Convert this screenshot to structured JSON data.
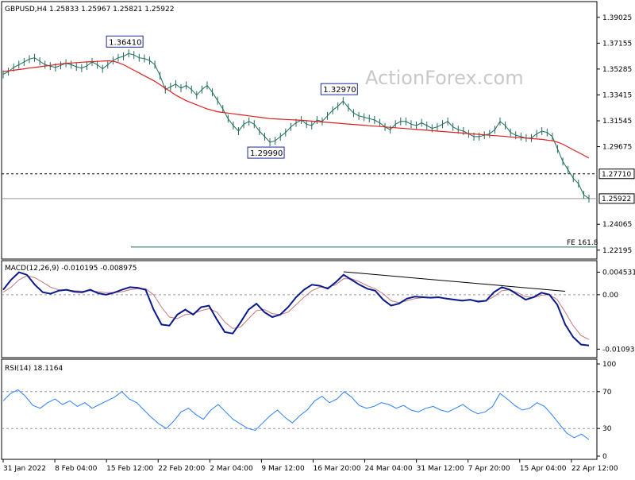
{
  "colors": {
    "price_bars": "#1f6b5c",
    "ma_line": "#e02020",
    "macd_line": "#0a1a8c",
    "signal_line": "#c87878",
    "rsi_line": "#2a7fff",
    "frame": "#000000",
    "guide": "#000000",
    "fe_line": "#1f6b5c"
  },
  "header": {
    "symbol_line": "GBPUSD,H4  1.25833 1.25967 1.25821 1.25922",
    "watermark": "ActionForex.com"
  },
  "chart_data": [
    {
      "type": "line",
      "pane": "price",
      "title": "GBPUSD,H4  1.25833 1.25967 1.25821 1.25922",
      "ylim": [
        1.2178,
        1.3993
      ],
      "y_ticks": [
        "1.39025",
        "1.37155",
        "1.35285",
        "1.33415",
        "1.31545",
        "1.29675",
        "1.27710",
        "1.25922",
        "1.24065",
        "1.22195"
      ],
      "x_ticks": [
        "31 Jan 2022",
        "8 Feb 04:00",
        "15 Feb 12:00",
        "22 Feb 20:00",
        "2 Mar 04:00",
        "9 Mar 12:00",
        "16 Mar 20:00",
        "24 Mar 04:00",
        "31 Mar 12:00",
        "7 Apr 20:00",
        "15 Apr 04:00",
        "22 Apr 12:00"
      ],
      "series": [
        {
          "name": "GBPUSD close",
          "values": [
            1.349,
            1.351,
            1.354,
            1.356,
            1.358,
            1.36,
            1.361,
            1.3585,
            1.356,
            1.355,
            1.354,
            1.3555,
            1.357,
            1.356,
            1.3545,
            1.3535,
            1.355,
            1.358,
            1.356,
            1.353,
            1.356,
            1.359,
            1.361,
            1.362,
            1.3641,
            1.363,
            1.361,
            1.3605,
            1.359,
            1.356,
            1.348,
            1.338,
            1.34,
            1.342,
            1.339,
            1.341,
            1.338,
            1.334,
            1.338,
            1.341,
            1.336,
            1.33,
            1.324,
            1.317,
            1.312,
            1.308,
            1.313,
            1.315,
            1.313,
            1.308,
            1.304,
            1.2999,
            1.301,
            1.304,
            1.307,
            1.311,
            1.314,
            1.316,
            1.313,
            1.312,
            1.316,
            1.315,
            1.319,
            1.323,
            1.326,
            1.3297,
            1.325,
            1.321,
            1.319,
            1.318,
            1.317,
            1.316,
            1.314,
            1.311,
            1.309,
            1.313,
            1.315,
            1.315,
            1.313,
            1.312,
            1.314,
            1.312,
            1.31,
            1.311,
            1.313,
            1.315,
            1.311,
            1.309,
            1.308,
            1.306,
            1.304,
            1.304,
            1.305,
            1.306,
            1.309,
            1.315,
            1.312,
            1.307,
            1.305,
            1.304,
            1.303,
            1.303,
            1.306,
            1.308,
            1.307,
            1.304,
            1.295,
            1.286,
            1.28,
            1.274,
            1.27,
            1.262,
            1.2592
          ]
        },
        {
          "name": "Moving average",
          "values": [
            1.351,
            1.3515,
            1.352,
            1.3525,
            1.353,
            1.3535,
            1.354,
            1.3545,
            1.355,
            1.3555,
            1.356,
            1.3565,
            1.357,
            1.3572,
            1.3575,
            1.3578,
            1.358,
            1.3582,
            1.3584,
            1.3586,
            1.3588,
            1.3585,
            1.3575,
            1.356,
            1.354,
            1.352,
            1.35,
            1.348,
            1.346,
            1.344,
            1.3415,
            1.339,
            1.3365,
            1.334,
            1.332,
            1.33,
            1.3285,
            1.327,
            1.3255,
            1.324,
            1.323,
            1.322,
            1.3215,
            1.321,
            1.3205,
            1.32,
            1.3195,
            1.319,
            1.3185,
            1.318,
            1.3175,
            1.317,
            1.3168,
            1.3166,
            1.3164,
            1.3162,
            1.316,
            1.3158,
            1.3155,
            1.3152,
            1.3149,
            1.3146,
            1.3143,
            1.314,
            1.3137,
            1.3134,
            1.3131,
            1.3128,
            1.3125,
            1.3122,
            1.3119,
            1.3116,
            1.3113,
            1.311,
            1.3107,
            1.3104,
            1.3101,
            1.3098,
            1.3095,
            1.3092,
            1.3089,
            1.3086,
            1.3083,
            1.308,
            1.3077,
            1.3074,
            1.3071,
            1.3068,
            1.3065,
            1.3062,
            1.3059,
            1.3056,
            1.3053,
            1.305,
            1.3047,
            1.3044,
            1.3041,
            1.3038,
            1.3035,
            1.3032,
            1.3029,
            1.3026,
            1.3023,
            1.302,
            1.3015,
            1.301,
            1.3,
            1.2985,
            1.2965,
            1.2945,
            1.2925,
            1.2905,
            1.2885
          ]
        }
      ],
      "annotations": [
        {
          "label": "1.36410",
          "x_index": 24,
          "y": 1.3641
        },
        {
          "label": "1.32970",
          "x_index": 65,
          "y": 1.3297
        },
        {
          "label": "1.29990",
          "x_index": 51,
          "y": 1.2999
        }
      ],
      "levels": [
        {
          "label": "1.27710",
          "value": 1.2771,
          "style": "dashed"
        },
        {
          "label": "1.25922",
          "value": 1.25922,
          "style": "solid"
        }
      ],
      "fe_label": "FE 161.8",
      "fe_value": 1.2242
    },
    {
      "type": "line",
      "pane": "macd",
      "title": "MACD(12,26,9) -0.010195 -0.008975",
      "ylim": [
        -0.012,
        0.0062
      ],
      "y_ticks": [
        "0.004531",
        "0.00",
        "-0.010939"
      ],
      "series": [
        {
          "name": "MACD",
          "values": [
            0.001,
            0.003,
            0.0045,
            0.004,
            0.002,
            0.0005,
            0.0002,
            0.0008,
            0.001,
            0.0006,
            0.0005,
            0.001,
            0.0003,
            0.0,
            0.0004,
            0.001,
            0.0015,
            0.0014,
            0.001,
            -0.003,
            -0.006,
            -0.0062,
            -0.004,
            -0.003,
            -0.004,
            -0.0025,
            -0.0022,
            -0.005,
            -0.0075,
            -0.0078,
            -0.0055,
            -0.003,
            -0.0018,
            -0.0035,
            -0.0045,
            -0.004,
            -0.0025,
            -0.0005,
            0.001,
            0.002,
            0.0018,
            0.0012,
            0.0025,
            0.004,
            0.003,
            0.002,
            0.0012,
            0.0008,
            -0.001,
            -0.0022,
            -0.0018,
            -0.0008,
            -0.0004,
            -0.0005,
            -0.0006,
            -0.0005,
            -0.0008,
            -0.001,
            -0.0012,
            -0.001,
            -0.0014,
            -0.0012,
            0.0005,
            0.0015,
            0.001,
            0.0,
            -0.001,
            -0.0005,
            0.0004,
            0.0,
            -0.002,
            -0.006,
            -0.0085,
            -0.01,
            -0.0102
          ]
        },
        {
          "name": "Signal",
          "values": [
            0.0005,
            0.0015,
            0.003,
            0.0038,
            0.0034,
            0.0025,
            0.0015,
            0.001,
            0.0009,
            0.0008,
            0.0007,
            0.0008,
            0.0006,
            0.0004,
            0.0004,
            0.0006,
            0.001,
            0.0012,
            0.0012,
            0.0,
            -0.0025,
            -0.0045,
            -0.0048,
            -0.004,
            -0.0038,
            -0.0032,
            -0.0028,
            -0.0035,
            -0.0055,
            -0.0068,
            -0.0065,
            -0.0048,
            -0.0032,
            -0.003,
            -0.0038,
            -0.004,
            -0.0035,
            -0.002,
            -0.0005,
            0.0008,
            0.0015,
            0.0015,
            0.002,
            0.0032,
            0.0032,
            0.0026,
            0.0018,
            0.0012,
            0.0002,
            -0.0012,
            -0.0016,
            -0.0012,
            -0.0008,
            -0.0006,
            -0.0006,
            -0.0006,
            -0.0007,
            -0.0009,
            -0.0011,
            -0.0011,
            -0.0012,
            -0.0012,
            -0.0004,
            0.0008,
            0.001,
            0.0004,
            -0.0004,
            -0.0006,
            -0.0001,
            0.0,
            -0.001,
            -0.0035,
            -0.0062,
            -0.0082,
            -0.009
          ]
        }
      ]
    },
    {
      "type": "line",
      "pane": "rsi",
      "title": "RSI(14) 18.1164",
      "ylim": [
        0,
        100
      ],
      "y_ticks": [
        "100",
        "70",
        "30",
        "0"
      ],
      "series": [
        {
          "name": "RSI(14)",
          "values": [
            60,
            68,
            72,
            65,
            55,
            52,
            58,
            62,
            56,
            60,
            54,
            58,
            52,
            56,
            60,
            64,
            70,
            62,
            58,
            50,
            42,
            35,
            30,
            38,
            48,
            52,
            45,
            40,
            50,
            56,
            48,
            40,
            35,
            30,
            28,
            36,
            44,
            50,
            42,
            36,
            44,
            50,
            60,
            65,
            58,
            62,
            70,
            64,
            55,
            52,
            54,
            58,
            56,
            52,
            55,
            50,
            48,
            52,
            54,
            50,
            48,
            52,
            56,
            50,
            46,
            48,
            54,
            68,
            62,
            55,
            50,
            52,
            58,
            54,
            45,
            35,
            25,
            20,
            24,
            18
          ]
        }
      ],
      "levels": [
        70,
        30
      ]
    }
  ]
}
